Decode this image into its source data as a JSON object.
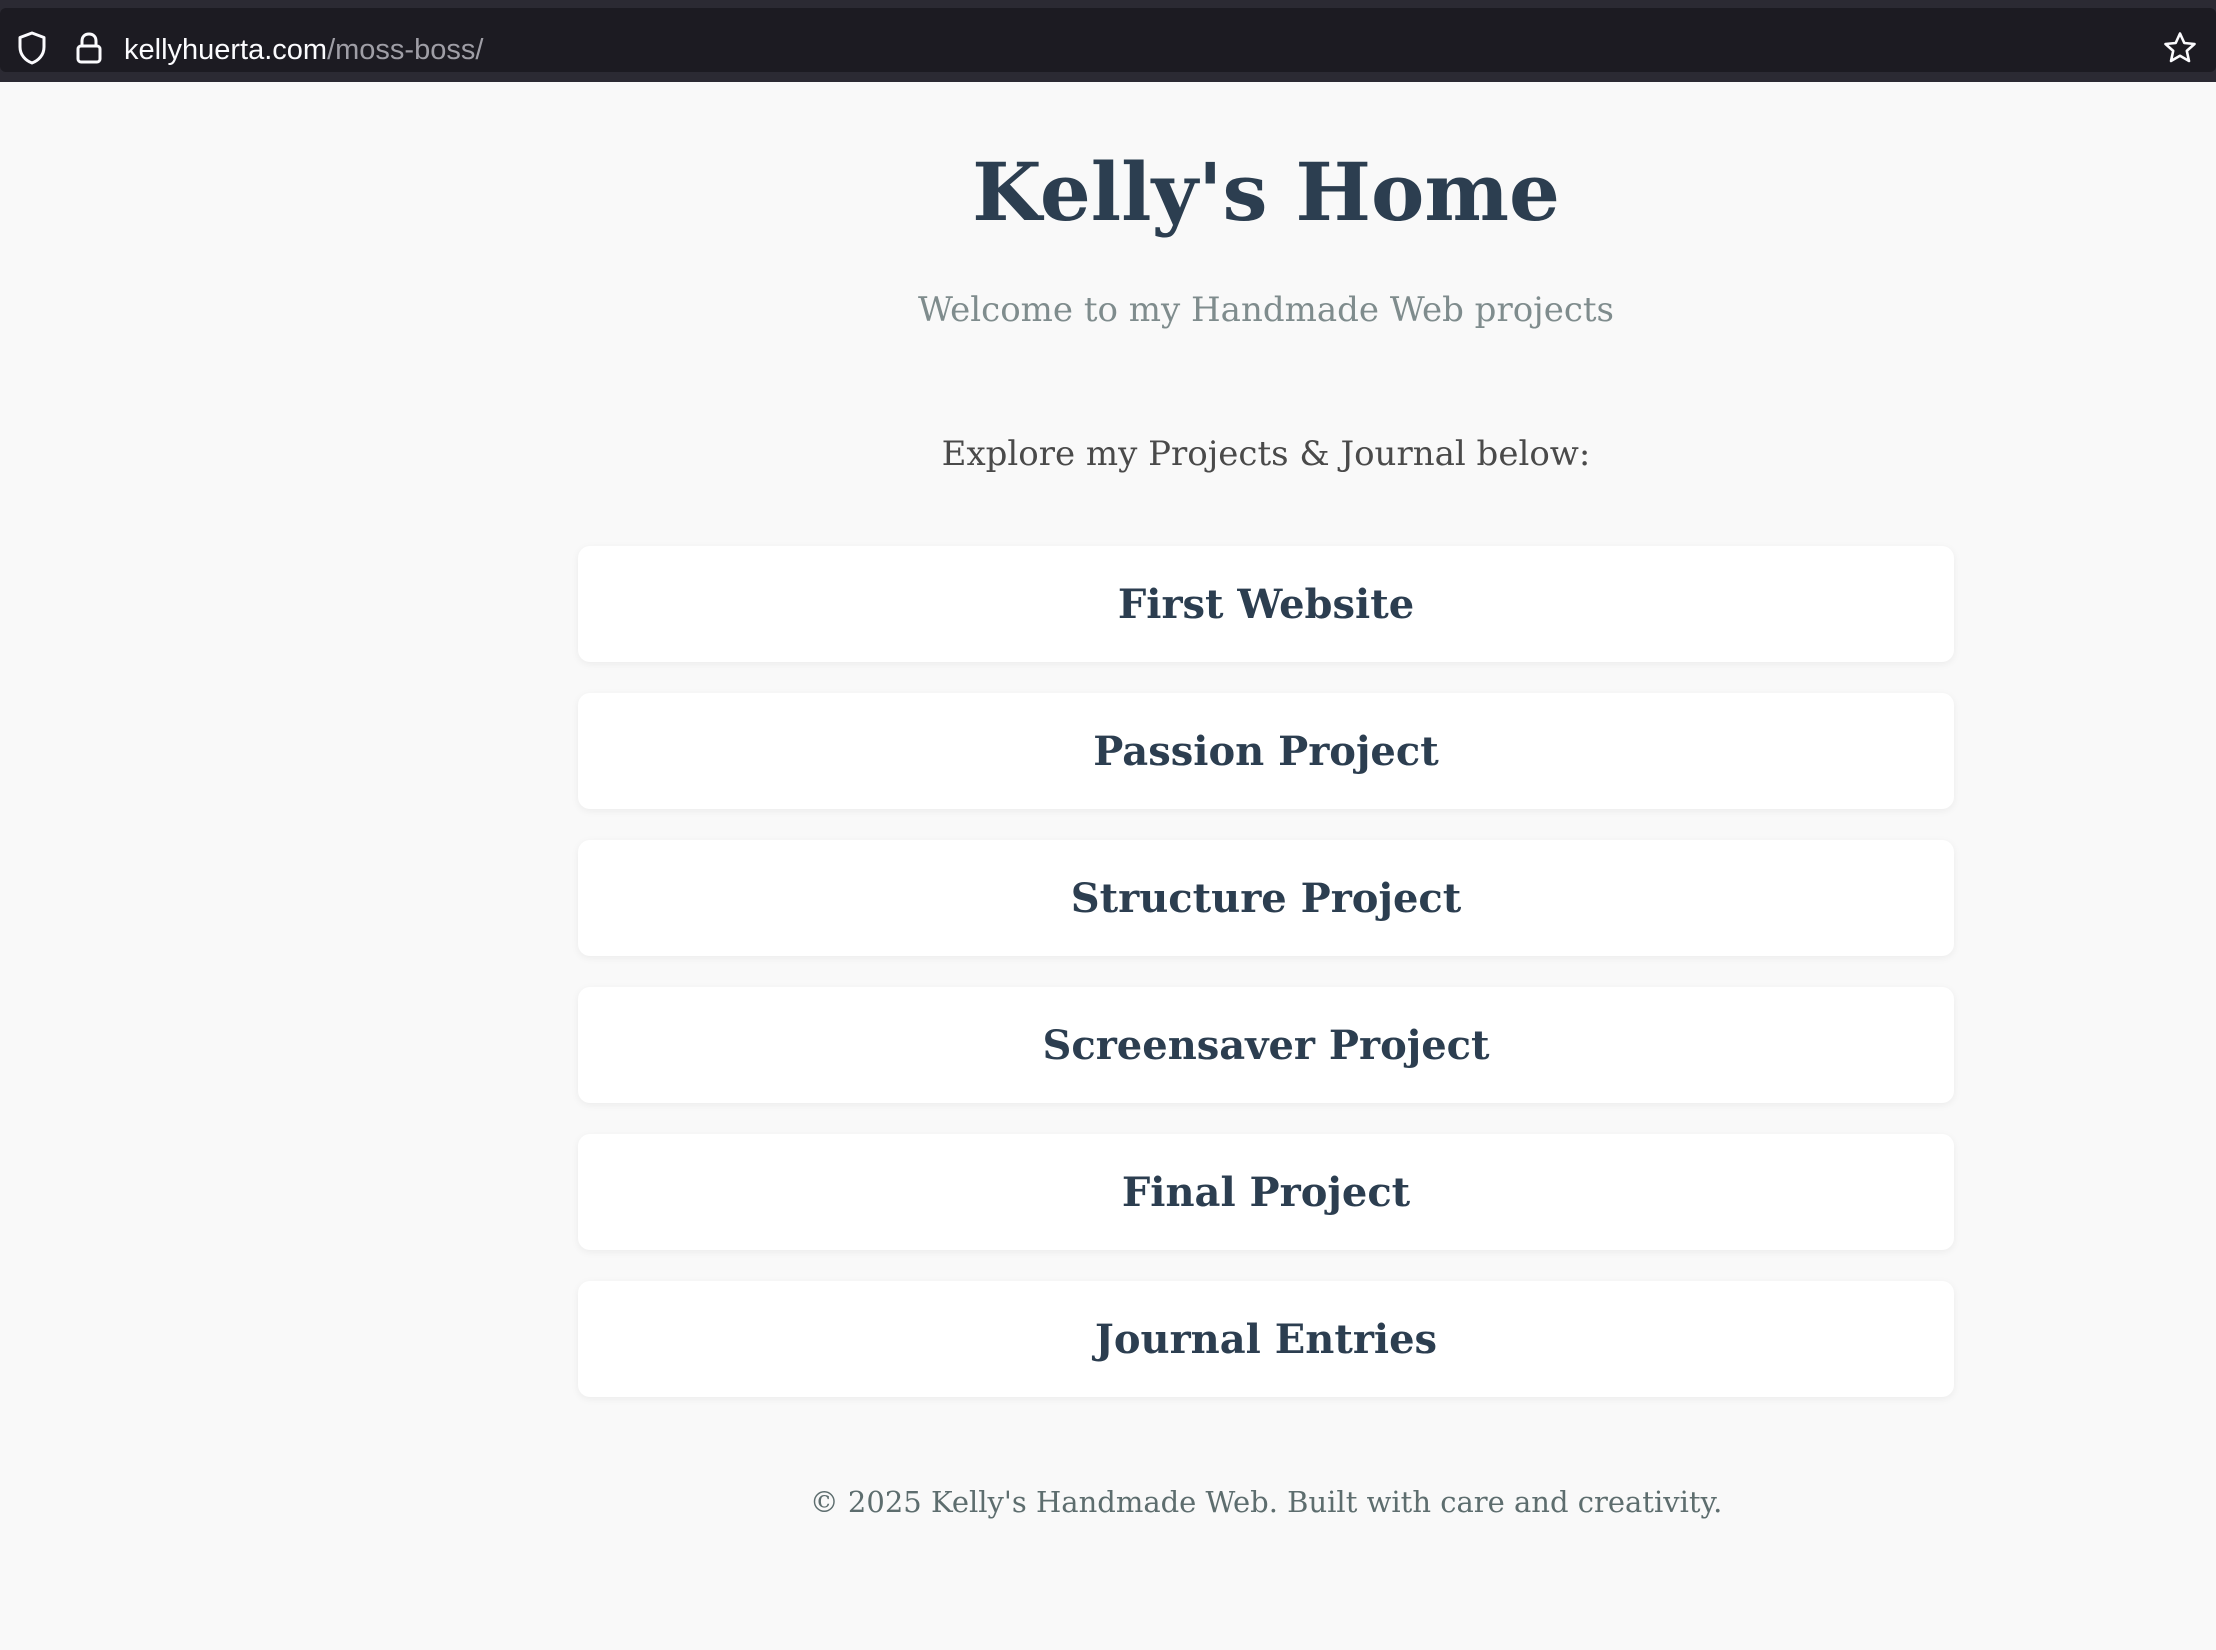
{
  "browser": {
    "url_host": "kellyhuerta.com",
    "url_path": "/moss-boss/",
    "icons": {
      "security": "shield-icon",
      "connection": "lock-icon",
      "bookmark": "star-icon"
    }
  },
  "header": {
    "title": "Kelly's Home",
    "subtitle": "Welcome to my Handmade Web projects"
  },
  "main": {
    "intro": "Explore my Projects & Journal below:",
    "links": [
      {
        "label": "First Website"
      },
      {
        "label": "Passion Project"
      },
      {
        "label": "Structure Project"
      },
      {
        "label": "Screensaver Project"
      },
      {
        "label": "Final Project"
      },
      {
        "label": "Journal Entries"
      }
    ]
  },
  "footer": {
    "text": "© 2025 Kelly's Handmade Web. Built with care and creativity."
  },
  "colors": {
    "heading": "#2c3e50",
    "subtitle": "#7f8c8d",
    "page_background": "#f9f9f9",
    "card_background": "#ffffff",
    "browser_chrome": "#1c1b22"
  }
}
